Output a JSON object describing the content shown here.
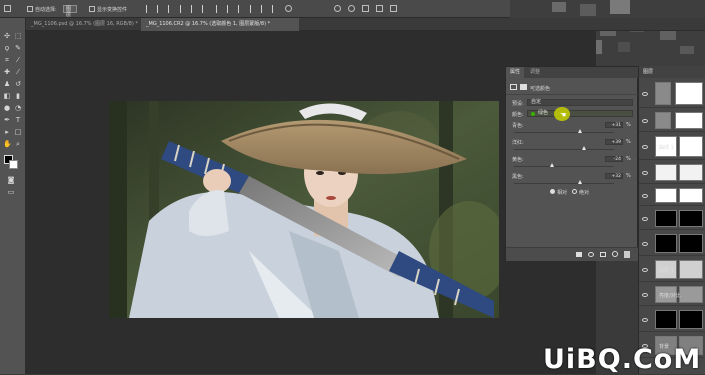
{
  "options_bar": {
    "auto_select_label": "自动选择:",
    "auto_select_value": "图层",
    "transform_controls_label": "显示变换控件"
  },
  "tabs": [
    {
      "label": "_MG_1106.psd @ 16.7% (图层 16, RGB/8) *"
    },
    {
      "label": "_MG_1106.CR2 @ 16.7% (选取颜色 1, 图层蒙版/8) *"
    }
  ],
  "properties": {
    "tab_properties": "属性",
    "tab_adjust": "调整",
    "adjustment_name": "可选颜色",
    "preset_label": "预设:",
    "preset_value": "自定",
    "color_label": "颜色:",
    "color_value": "绿色",
    "sliders": [
      {
        "label": "青色:",
        "value": "+31",
        "unit": "%",
        "level": 0.66
      },
      {
        "label": "洋红:",
        "value": "+39",
        "unit": "%",
        "level": 0.7
      },
      {
        "label": "黄色:",
        "value": "-24",
        "unit": "%",
        "level": 0.38
      },
      {
        "label": "黑色:",
        "value": "+32",
        "unit": "%",
        "level": 0.66
      }
    ],
    "method_relative": "相对",
    "method_absolute": "绝对"
  },
  "layers_panel": {
    "header": "图层",
    "layers": [
      {
        "name": "",
        "thumb": "#ffffff"
      },
      {
        "name": "",
        "thumb": "#ffffff"
      },
      {
        "name": "曲线 1",
        "thumb": "#ffffff"
      },
      {
        "name": "",
        "thumb": "#f2f2f2"
      },
      {
        "name": "",
        "thumb": "#ffffff"
      },
      {
        "name": "",
        "thumb": "#000000"
      },
      {
        "name": "",
        "thumb": "#000000"
      },
      {
        "name": "图层 1",
        "thumb": "#d0d0d0"
      },
      {
        "name": "亮度/对比",
        "thumb": "#9a9a9a"
      },
      {
        "name": "",
        "thumb": "#000000"
      },
      {
        "name": "背景",
        "thumb": "#808080"
      }
    ]
  },
  "watermark": "UiBQ.CoM",
  "colors": {
    "accent_yellow": "#c7d000",
    "photo_sky": "#3d4a33",
    "sword_blue": "#2e4a80"
  }
}
